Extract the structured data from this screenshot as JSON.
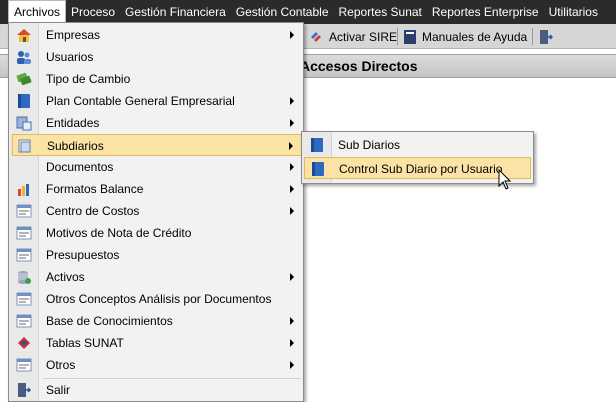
{
  "menubar": {
    "items": [
      {
        "label": "Archivos"
      },
      {
        "label": "Proceso"
      },
      {
        "label": "Gestión Financiera"
      },
      {
        "label": "Gestión Contable"
      },
      {
        "label": "Reportes Sunat"
      },
      {
        "label": "Reportes Enterprise"
      },
      {
        "label": "Utilitarios"
      }
    ]
  },
  "toolbar": {
    "activar_sire": "Activar SIRE",
    "manuales": "Manuales de Ayuda"
  },
  "main": {
    "panel_title": "Accesos Directos"
  },
  "dropdown": {
    "items": [
      {
        "label": "Empresas",
        "icon": "house-icon",
        "has_submenu": true
      },
      {
        "label": "Usuarios",
        "icon": "users-icon",
        "has_submenu": false
      },
      {
        "label": "Tipo de Cambio",
        "icon": "exchange-icon",
        "has_submenu": false
      },
      {
        "label": "Plan Contable General Empresarial",
        "icon": "book-icon",
        "has_submenu": true
      },
      {
        "label": "Entidades",
        "icon": "entities-icon",
        "has_submenu": true
      },
      {
        "label": "Subdiarios",
        "icon": "journal-icon",
        "has_submenu": true,
        "highlighted": true
      },
      {
        "label": "Documentos",
        "icon": "blank-icon",
        "has_submenu": true
      },
      {
        "label": "Formatos Balance",
        "icon": "chart-icon",
        "has_submenu": true
      },
      {
        "label": "Centro de Costos",
        "icon": "form-icon",
        "has_submenu": true
      },
      {
        "label": "Motivos de Nota de Crédito",
        "icon": "form-icon",
        "has_submenu": false
      },
      {
        "label": "Presupuestos",
        "icon": "form-icon",
        "has_submenu": false
      },
      {
        "label": "Activos",
        "icon": "database-icon",
        "has_submenu": true
      },
      {
        "label": "Otros Conceptos Análisis por Documentos",
        "icon": "form-icon",
        "has_submenu": false
      },
      {
        "label": "Base de Conocimientos",
        "icon": "form-icon",
        "has_submenu": true
      },
      {
        "label": "Tablas SUNAT",
        "icon": "sunat-icon",
        "has_submenu": true
      },
      {
        "label": "Otros",
        "icon": "form-icon",
        "has_submenu": true
      },
      {
        "label": "Salir",
        "icon": "exit-icon",
        "has_submenu": false
      }
    ]
  },
  "submenu": {
    "items": [
      {
        "label": "Sub Diarios",
        "icon": "book-icon"
      },
      {
        "label": "Control Sub Diario por Usuario",
        "icon": "book-icon",
        "highlighted": true
      }
    ]
  },
  "colors": {
    "menubar_bg": "#2b2b2b",
    "highlight_bg": "#fbe3a6",
    "highlight_border": "#e4b95c",
    "menu_bg": "#f2f2f2"
  }
}
